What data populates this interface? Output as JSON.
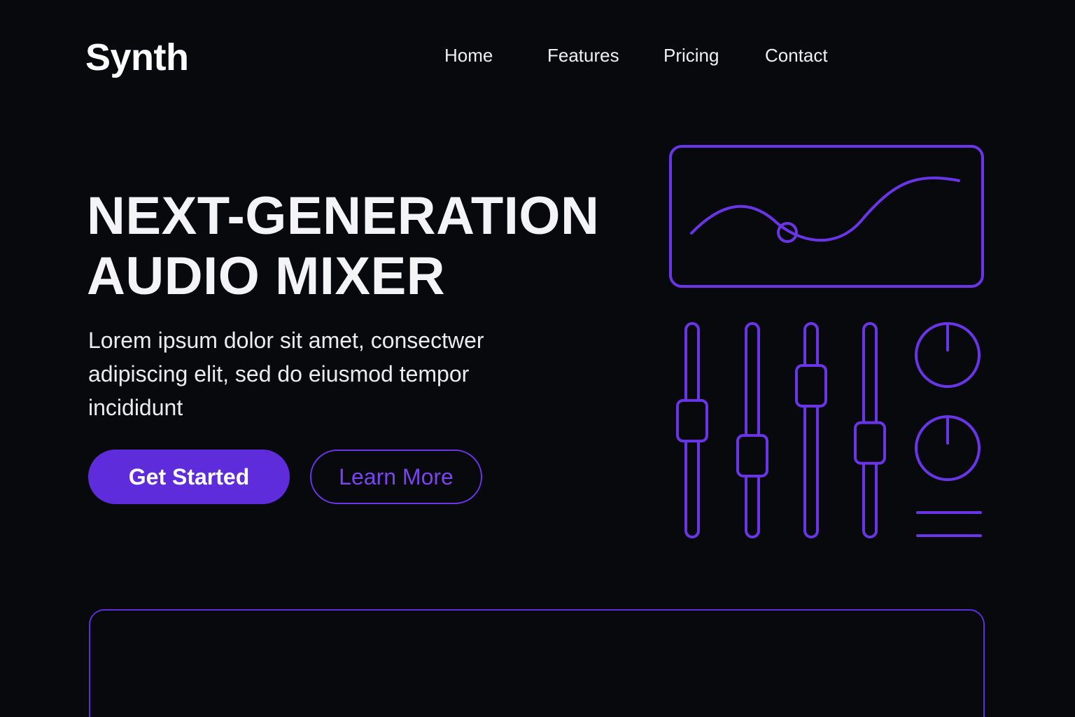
{
  "brand": {
    "logo_text": "Synth"
  },
  "nav": {
    "items": [
      {
        "label": "Home"
      },
      {
        "label": "Features"
      },
      {
        "label": "Pricing"
      },
      {
        "label": "Contact"
      }
    ]
  },
  "hero": {
    "headline_line1": "NEXT-GENERATION",
    "headline_line2": "AUDIO MIXER",
    "lede": "Lorem ipsum dolor sit amet, consectwer adipiscing elit, sed do eiusmod tempor incididunt",
    "primary_cta": "Get Started",
    "secondary_cta": "Learn More"
  },
  "mixer": {
    "faders": [
      {
        "level": 0.56
      },
      {
        "level": 0.34
      },
      {
        "level": 0.78
      },
      {
        "level": 0.42
      }
    ],
    "knobs": [
      {
        "value": 0.5
      },
      {
        "value": 0.5
      }
    ]
  },
  "colors": {
    "background": "#07090c",
    "accent": "#5f2cdb",
    "accent_line": "#6a35e6",
    "text": "#f2f2f4"
  }
}
